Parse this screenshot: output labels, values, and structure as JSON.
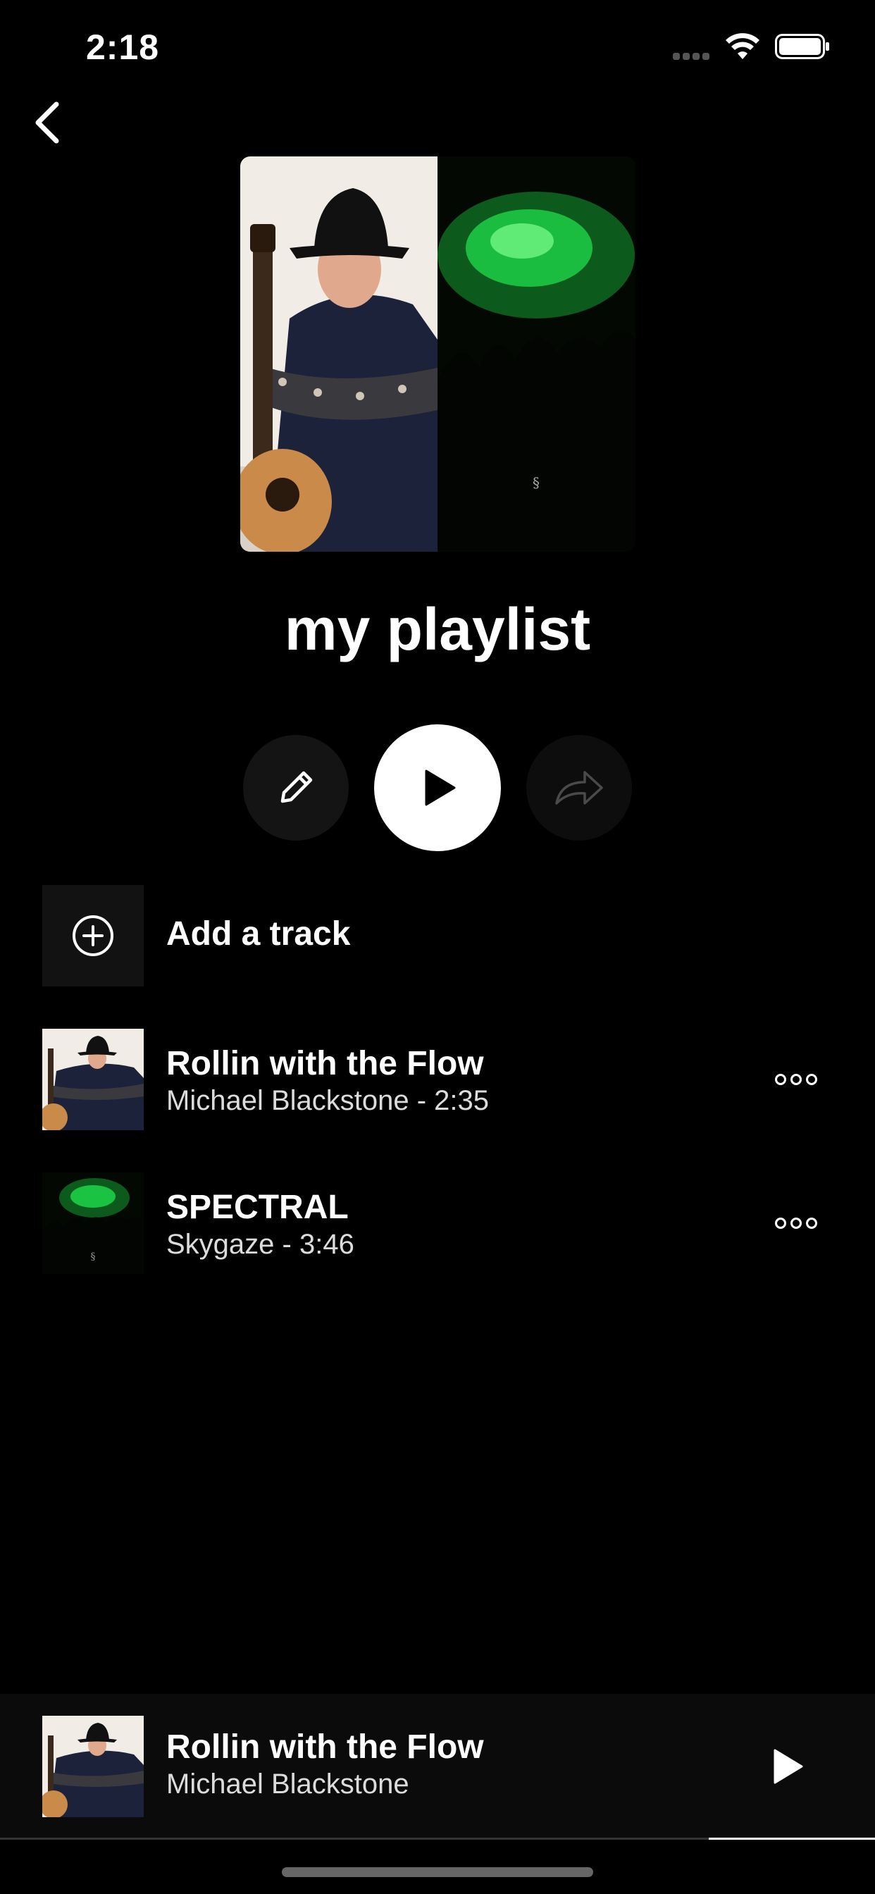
{
  "status_bar": {
    "time": "2:18"
  },
  "playlist": {
    "title": "my playlist"
  },
  "actions": {
    "edit_icon": "pencil-icon",
    "play_icon": "play-icon",
    "share_icon": "share-arrow-icon"
  },
  "add_track": {
    "label": "Add a track",
    "icon": "plus-circle-icon"
  },
  "tracks": [
    {
      "title": "Rollin with the Flow",
      "subtitle": "Michael Blackstone - 2:35"
    },
    {
      "title": "SPECTRAL",
      "subtitle": "Skygaze - 3:46"
    }
  ],
  "now_playing": {
    "title": "Rollin with the Flow",
    "artist": "Michael Blackstone",
    "progress_fraction": 0.19
  },
  "colors": {
    "background": "#000000",
    "accent_green": "#1fd64a"
  }
}
